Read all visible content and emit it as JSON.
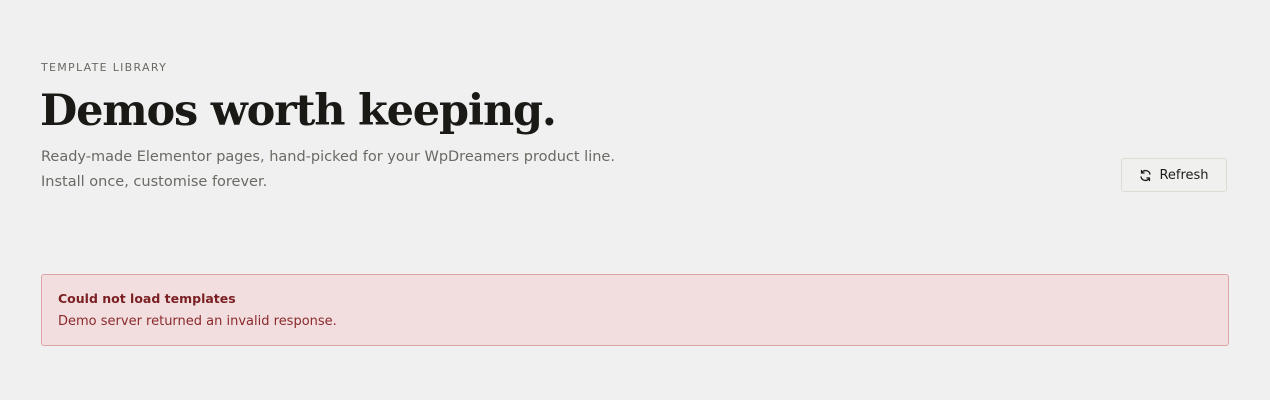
{
  "header": {
    "eyebrow": "TEMPLATE LIBRARY",
    "title": "Demos worth keeping.",
    "subtitle_lines": [
      "Ready-made Elementor pages, hand-picked for your WpDreamers product line.",
      "Install once, customise forever."
    ]
  },
  "toolbar": {
    "refresh_label": "Refresh",
    "refresh_icon": "refresh-icon"
  },
  "error": {
    "title": "Could not load templates",
    "message": "Demo server returned an invalid response."
  },
  "colors": {
    "background": "#f0f0f0",
    "error_background": "#f2dede",
    "error_border": "#dca5a7",
    "error_text": "#8b2a2d"
  }
}
